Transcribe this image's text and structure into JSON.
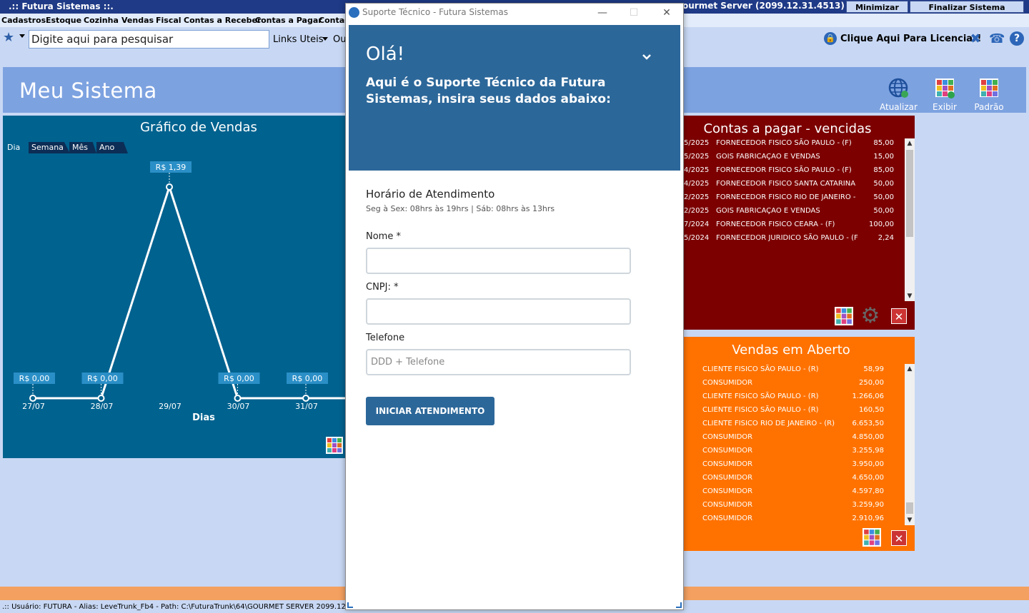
{
  "titlebar": {
    "app_title": ".:: Futura Sistemas ::.",
    "server_title": "ourmet Server (2099.12.31.4513)",
    "minimize_label": "Minimizar",
    "finish_label": "Finalizar Sistema"
  },
  "menu": [
    "Cadastros",
    "Estoque",
    "Cozinha",
    "Vendas",
    "Fiscal",
    "Contas a Receber",
    "Contas a Pagar",
    "Contas"
  ],
  "toolbar": {
    "search_placeholder": "Digite aqui para pesquisar",
    "links_label": "Links Uteis",
    "ou_label": "Ou",
    "license_label": "Clique Aqui Para Licenciar!"
  },
  "band": {
    "title": "Meu Sistema",
    "refresh_label": "Atualizar",
    "show_label": "Exibir",
    "default_label": "Padrão"
  },
  "chart_panel": {
    "period_tabs": [
      "Dia",
      "Semana",
      "Mês",
      "Ano"
    ]
  },
  "chart_data": {
    "type": "line",
    "title": "Gráfico de Vendas",
    "xlabel": "Dias",
    "ylabel": "",
    "categories": [
      "27/07",
      "28/07",
      "29/07",
      "30/07",
      "31/07"
    ],
    "values": [
      0.0,
      0.0,
      1.39,
      0.0,
      0.0
    ],
    "data_labels": [
      "R$ 0,00",
      "R$ 0,00",
      "R$ 1,39",
      "R$ 0,00",
      "R$ 0,00"
    ],
    "ylim": [
      0,
      1.39
    ],
    "grid": false,
    "colors": {
      "background": "#00628f",
      "line": "#ffffff",
      "label_bg": "#2b8fc7"
    }
  },
  "contas_pagar": {
    "title": "Contas a pagar - vencidas",
    "rows": [
      {
        "date": "5/2025",
        "name": "FORNECEDOR FISICO SÃO PAULO - (F)",
        "value": "85,00"
      },
      {
        "date": "5/2025",
        "name": "GOIS FABRICAÇAO E VENDAS",
        "value": "15,00"
      },
      {
        "date": "4/2025",
        "name": "FORNECEDOR FISICO SÃO PAULO - (F)",
        "value": "85,00"
      },
      {
        "date": "4/2025",
        "name": "FORNECEDOR FISICO SANTA CATARINA",
        "value": "50,00"
      },
      {
        "date": "2/2025",
        "name": "FORNECEDOR FISICO RIO DE JANEIRO -",
        "value": "50,00"
      },
      {
        "date": "2/2025",
        "name": "GOIS FABRICAÇAO E VENDAS",
        "value": "50,00"
      },
      {
        "date": "7/2024",
        "name": "FORNECEDOR FISICO CEARA - (F)",
        "value": "100,00"
      },
      {
        "date": "5/2024",
        "name": "FORNECEDOR JURIDICO SÃO PAULO - (F",
        "value": "2,24"
      }
    ]
  },
  "vendas_aberto": {
    "title": "Vendas em Aberto",
    "rows": [
      {
        "name": "CLIENTE FISICO SÃO PAULO -  (R)",
        "value": "58,99"
      },
      {
        "name": "CONSUMIDOR",
        "value": "250,00"
      },
      {
        "name": "CLIENTE FISICO SÃO PAULO -  (R)",
        "value": "1.266,06"
      },
      {
        "name": "CLIENTE FISICO SÃO PAULO -  (R)",
        "value": "160,50"
      },
      {
        "name": "CLIENTE FISICO RIO DE JANEIRO -  (R)",
        "value": "6.653,50"
      },
      {
        "name": "CONSUMIDOR",
        "value": "4.850,00"
      },
      {
        "name": "CONSUMIDOR",
        "value": "3.255,98"
      },
      {
        "name": "CONSUMIDOR",
        "value": "3.950,00"
      },
      {
        "name": "CONSUMIDOR",
        "value": "4.650,00"
      },
      {
        "name": "CONSUMIDOR",
        "value": "4.597,80"
      },
      {
        "name": "CONSUMIDOR",
        "value": "3.259,90"
      },
      {
        "name": "CONSUMIDOR",
        "value": "2.910,96"
      }
    ]
  },
  "status_bar": ".:: Usuário: FUTURA - Alias: LeveTrunk_Fb4 - Path: C:\\FuturaTrunk\\64\\GOURMET SERVER 2099.12.",
  "dialog": {
    "window_title": "Suporte Técnico - Futura Sistemas",
    "greeting": "Olá!",
    "subtitle": "Aqui é o Suporte Técnico da Futura Sistemas, insira seus dados abaixo:",
    "hours_title": "Horário de Atendimento",
    "hours_text": "Seg à Sex: 08hrs às 19hrs | Sáb: 08hrs às 13hrs",
    "name_label": "Nome *",
    "name_value": "",
    "cnpj_label": "CNPJ: *",
    "cnpj_value": "",
    "phone_label": "Telefone",
    "phone_placeholder": "DDD + Telefone",
    "start_button": "INICIAR ATENDIMENTO",
    "header_color": "#2c6799"
  }
}
